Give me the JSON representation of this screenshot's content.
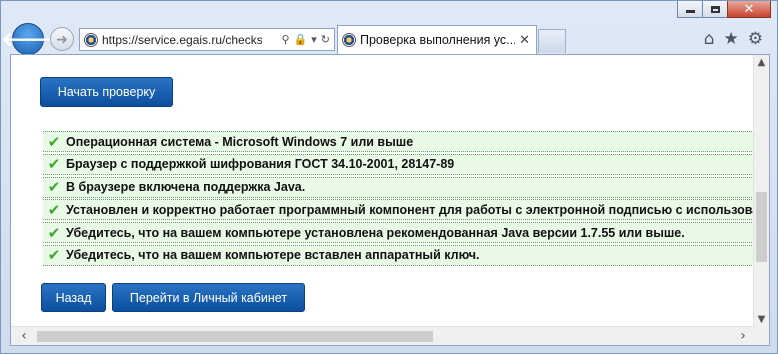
{
  "browser": {
    "url": "https://service.egais.ru/checks",
    "tab_title": "Проверка выполнения ус...",
    "tab_close": "✕",
    "back_icon": "arrow-left-icon",
    "forward_icon": "arrow-right-icon",
    "toolbar": [
      "home-icon",
      "star-icon",
      "gear-icon"
    ]
  },
  "page": {
    "start_check_button": "Начать проверку",
    "checks": [
      "Операционная система - Microsoft Windows 7 или выше",
      "Браузер с поддержкой шифрования ГОСТ 34.10-2001, 28147-89",
      "В браузере включена поддержка Java.",
      "Установлен и корректно работает программный компонент для работы с электронной подписью с использованием",
      "Убедитесь, что на вашем компьютере установлена рекомендованная Java версии 1.7.55 или выше.",
      "Убедитесь, что на вашем компьютере вставлен аппаратный ключ."
    ],
    "back_button": "Назад",
    "cabinet_button": "Перейти в Личный кабинет"
  },
  "colors": {
    "button_blue": "#0c4f9f",
    "check_green": "#3ea82e",
    "row_background": "#e8f9e6"
  }
}
